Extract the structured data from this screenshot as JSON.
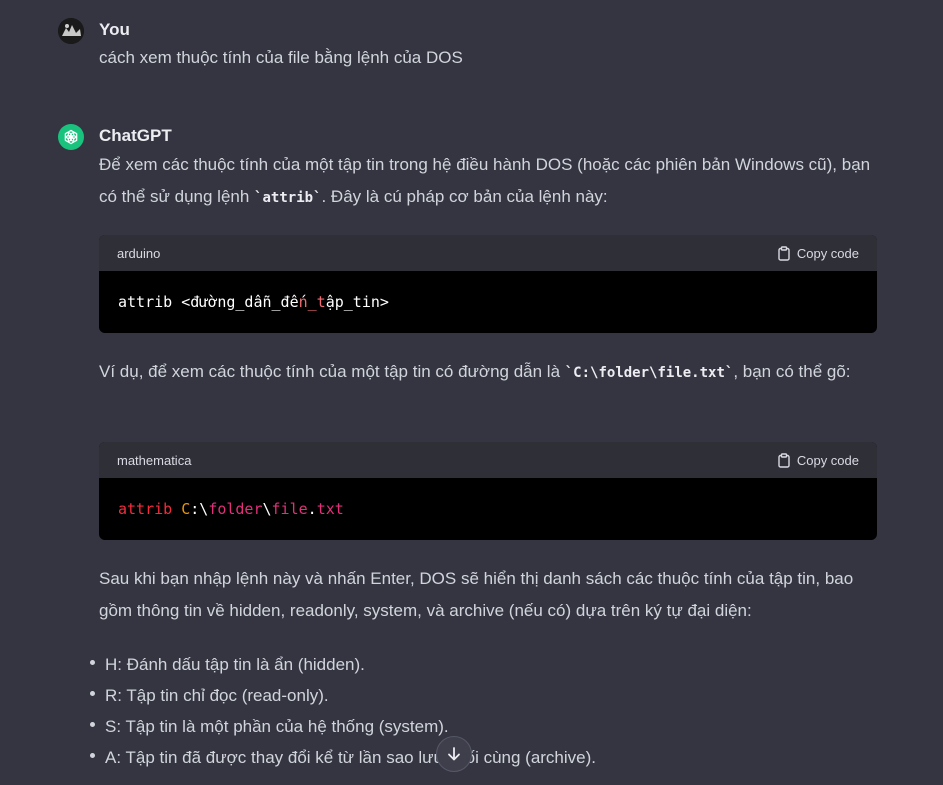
{
  "user_message": {
    "author": "You",
    "text": "cách xem thuộc tính của file bằng lệnh của DOS"
  },
  "assistant_message": {
    "author": "ChatGPT",
    "para1_before": "Để xem các thuộc tính của một tập tin trong hệ điều hành DOS (hoặc các phiên bản Windows cũ), bạn có thể sử dụng lệnh ",
    "para1_code": "`attrib`",
    "para1_after": ". Đây là cú pháp cơ bản của lệnh này:",
    "code1": {
      "language": "arduino",
      "copy_label": "Copy code",
      "part1": "attrib <đường_dẫn_đế",
      "part2": "n_t",
      "part3": "ập_tin>"
    },
    "para2_before": "Ví dụ, để xem các thuộc tính của một tập tin có đường dẫn là ",
    "para2_code": "`C:\\folder\\file.txt`",
    "para2_after": ", bạn có thể gõ:",
    "code2": {
      "language": "mathematica",
      "copy_label": "Copy code",
      "t1": "attrib",
      "t2": " ",
      "t3": "C",
      "t4": ":\\",
      "t5": "folder",
      "t6": "\\",
      "t7": "file",
      "t8": ".",
      "t9": "txt"
    },
    "para3": "Sau khi bạn nhập lệnh này và nhấn Enter, DOS sẽ hiển thị danh sách các thuộc tính của tập tin, bao gồm thông tin về hidden, readonly, system, và archive (nếu có) dựa trên ký tự đại diện:",
    "bullets": [
      "H: Đánh dấu tập tin là ẩn (hidden).",
      "R: Tập tin chỉ đọc (read-only).",
      "S: Tập tin là một phần của hệ thống (system).",
      "A: Tập tin đã được thay đổi kể từ lần sao lưu cuối cùng (archive)."
    ]
  },
  "icons": {
    "copy": "clipboard-icon",
    "scroll": "arrow-down-icon",
    "gpt": "openai-logo-icon"
  },
  "colors": {
    "background": "#343541",
    "code_bg": "#000000",
    "code_header": "#2f3037",
    "gpt_green": "#19c37d"
  }
}
